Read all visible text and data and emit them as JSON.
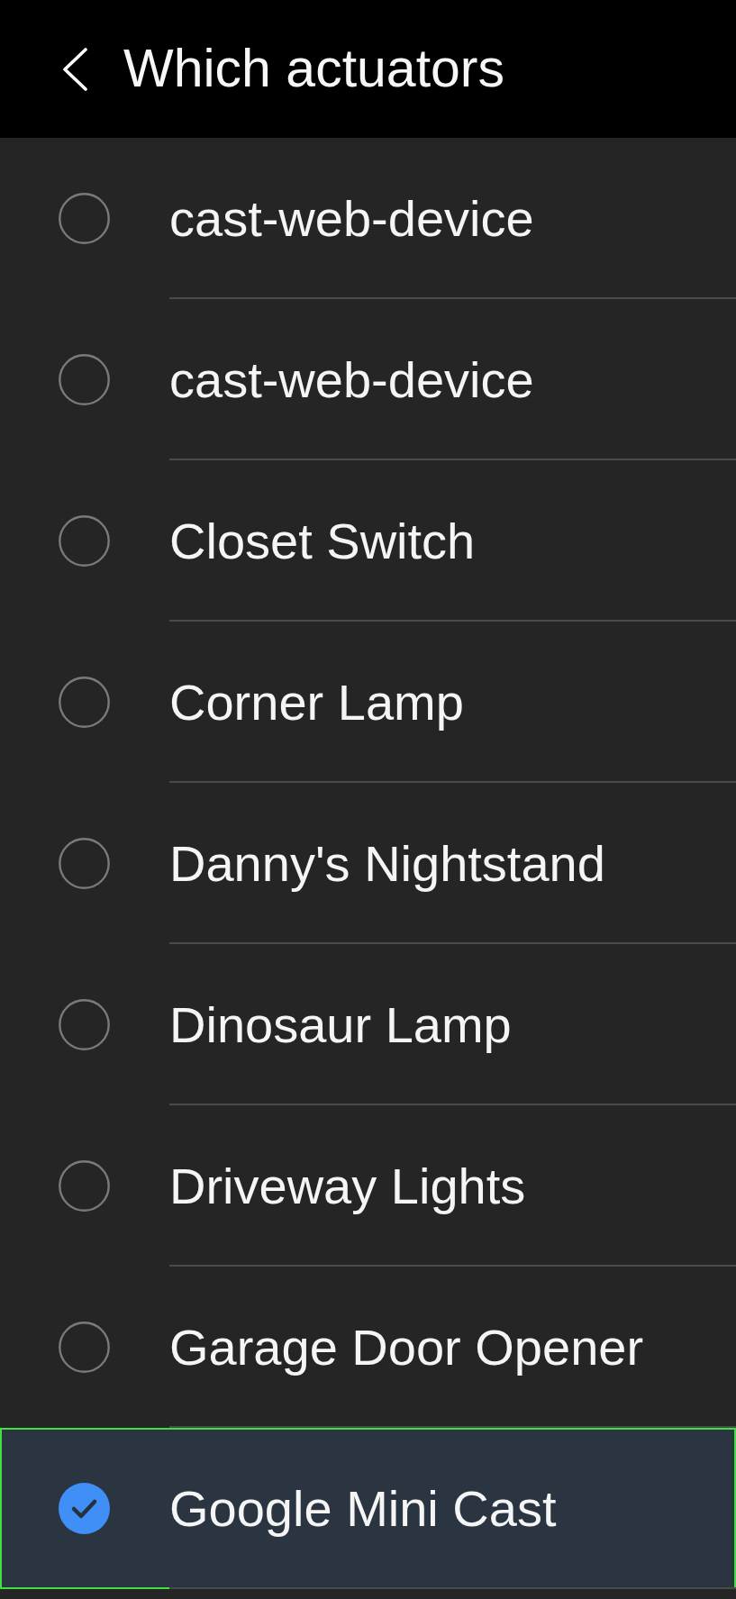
{
  "header": {
    "title": "Which actuators"
  },
  "options": [
    {
      "label": "cast-web-device",
      "selected": false
    },
    {
      "label": "cast-web-device",
      "selected": false
    },
    {
      "label": "Closet Switch",
      "selected": false
    },
    {
      "label": "Corner Lamp",
      "selected": false
    },
    {
      "label": "Danny's Nightstand",
      "selected": false
    },
    {
      "label": "Dinosaur Lamp",
      "selected": false
    },
    {
      "label": "Driveway Lights",
      "selected": false
    },
    {
      "label": "Garage Door Opener",
      "selected": false
    },
    {
      "label": "Google Mini Cast",
      "selected": true
    }
  ]
}
